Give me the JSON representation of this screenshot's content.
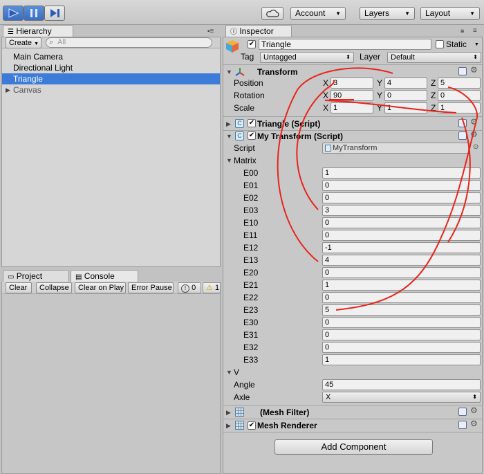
{
  "toolbar": {
    "account_label": "Account",
    "layers_label": "Layers",
    "layout_label": "Layout"
  },
  "hierarchy": {
    "tab_label": "Hierarchy",
    "create_label": "Create",
    "search_placeholder": "All",
    "items": [
      "Main Camera",
      "Directional Light",
      "Triangle",
      "Canvas"
    ]
  },
  "bottom_panel": {
    "tabs": [
      "Project",
      "Console"
    ],
    "buttons": [
      "Clear",
      "Collapse",
      "Clear on Play",
      "Error Pause"
    ],
    "info_count": "0",
    "warn_count": "1"
  },
  "inspector": {
    "tab_label": "Inspector",
    "object_name": "Triangle",
    "static_label": "Static",
    "tag_label": "Tag",
    "tag_value": "Untagged",
    "layer_label": "Layer",
    "layer_value": "Default",
    "transform": {
      "title": "Transform",
      "position_label": "Position",
      "rotation_label": "Rotation",
      "scale_label": "Scale",
      "axis_x": "X",
      "axis_y": "Y",
      "axis_z": "Z",
      "position": [
        "3",
        "4",
        "5"
      ],
      "rotation": [
        "90",
        "0",
        "0"
      ],
      "scale": [
        "1",
        "1",
        "1"
      ]
    },
    "triangle_script_title": "Triangle (Script)",
    "my_transform": {
      "title": "My Transform (Script)",
      "script_label": "Script",
      "script_value": "MyTransform",
      "matrix_label": "Matrix",
      "matrix": [
        {
          "label": "E00",
          "value": "1"
        },
        {
          "label": "E01",
          "value": "0"
        },
        {
          "label": "E02",
          "value": "0"
        },
        {
          "label": "E03",
          "value": "3"
        },
        {
          "label": "E10",
          "value": "0"
        },
        {
          "label": "E11",
          "value": "0"
        },
        {
          "label": "E12",
          "value": "-1"
        },
        {
          "label": "E13",
          "value": "4"
        },
        {
          "label": "E20",
          "value": "0"
        },
        {
          "label": "E21",
          "value": "1"
        },
        {
          "label": "E22",
          "value": "0"
        },
        {
          "label": "E23",
          "value": "5"
        },
        {
          "label": "E30",
          "value": "0"
        },
        {
          "label": "E31",
          "value": "0"
        },
        {
          "label": "E32",
          "value": "0"
        },
        {
          "label": "E33",
          "value": "1"
        }
      ],
      "v_label": "V",
      "angle_label": "Angle",
      "angle_value": "45",
      "axle_label": "Axle",
      "axle_value": "X"
    },
    "mesh_filter_title": "(Mesh Filter)",
    "mesh_renderer_title": "Mesh Renderer",
    "add_component_label": "Add Component"
  },
  "colors": {
    "selection": "#3d7bd8",
    "annotation": "#e8241c",
    "panel": "#c9c9c9"
  }
}
